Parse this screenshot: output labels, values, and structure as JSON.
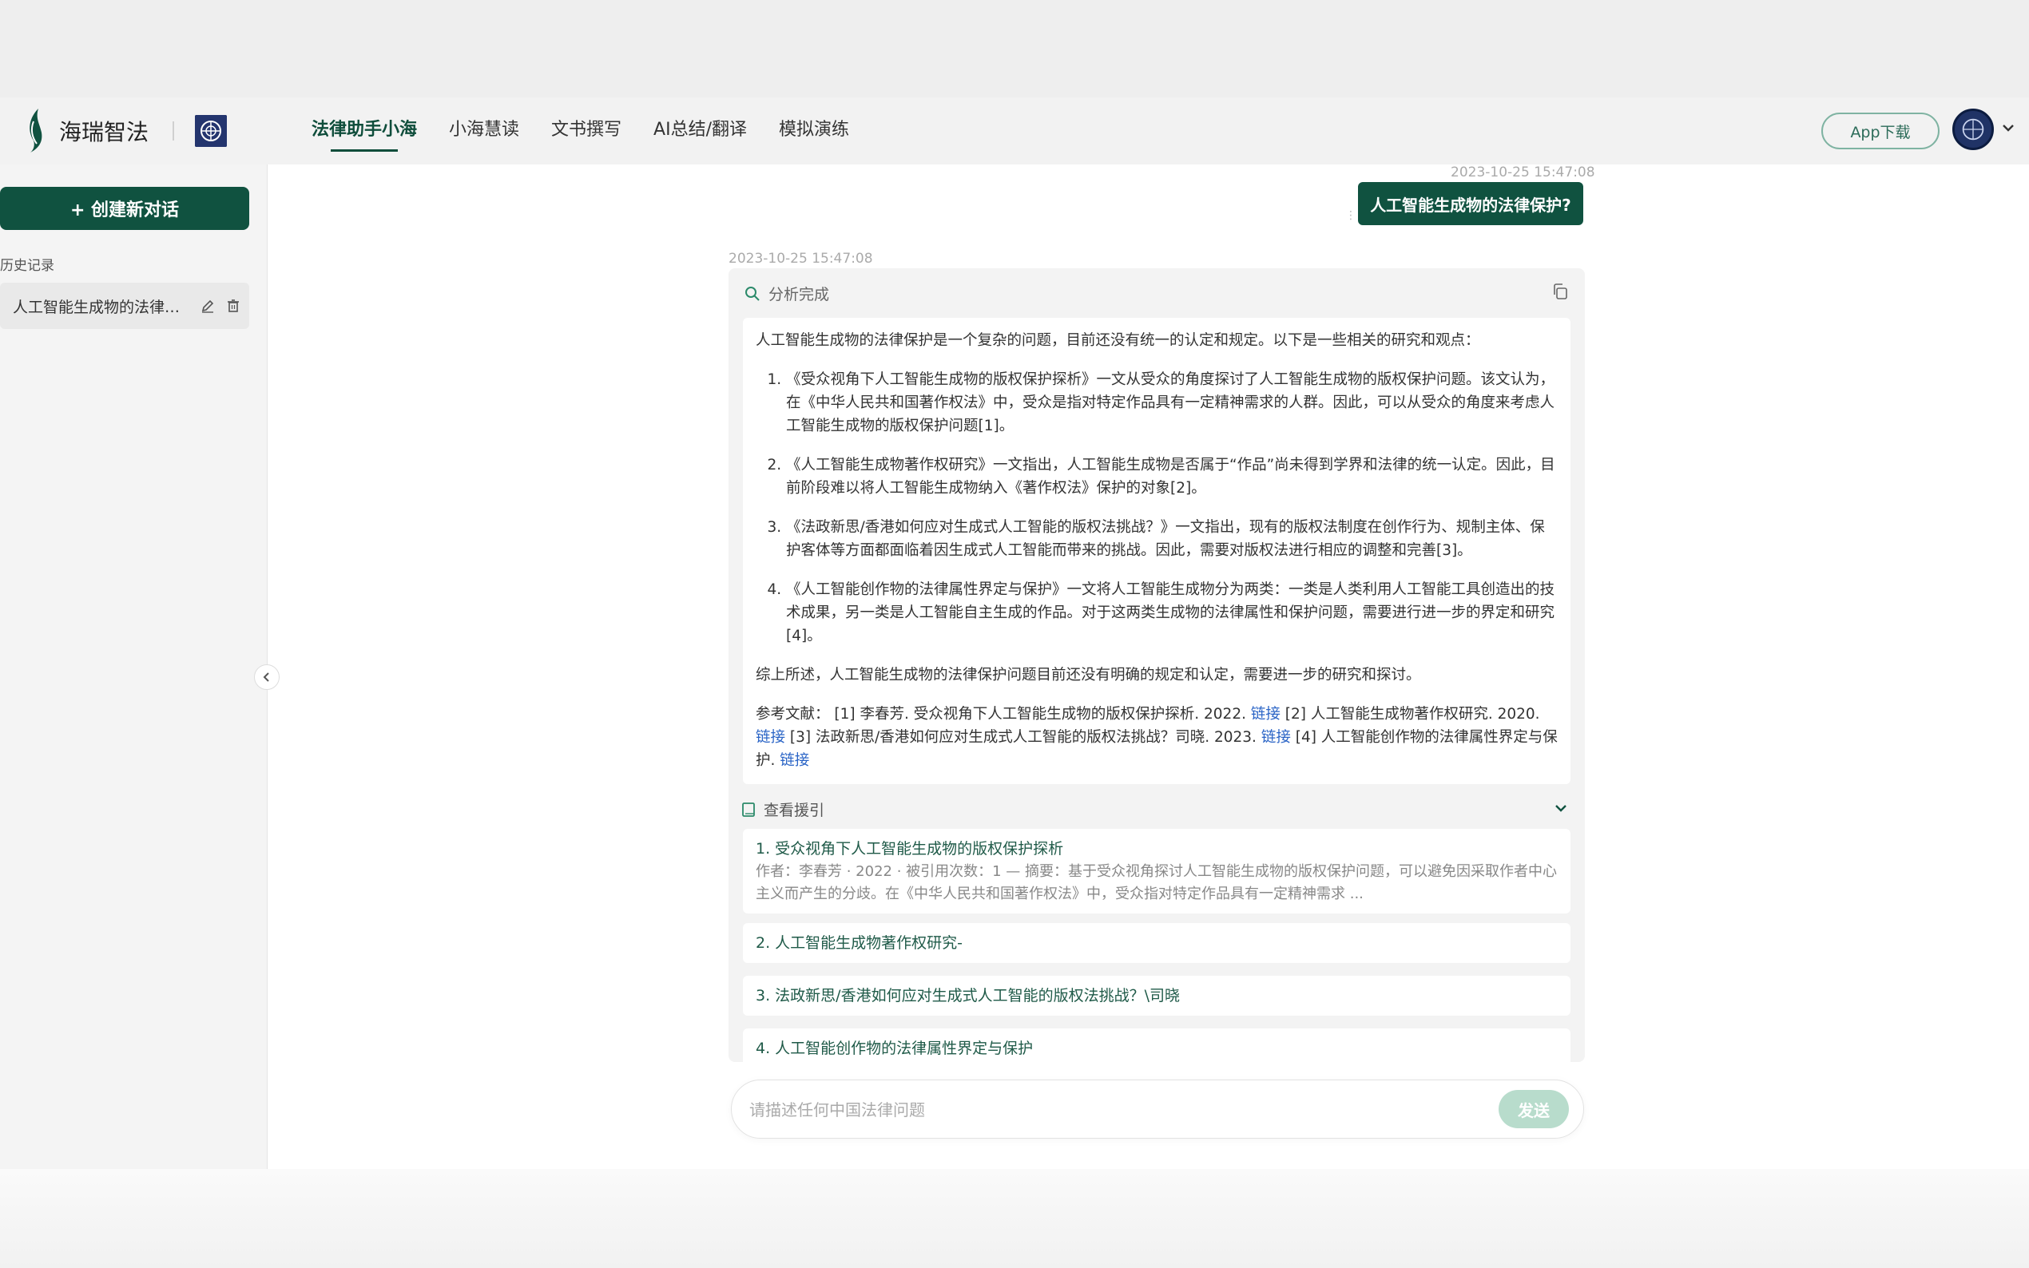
{
  "brand": {
    "name": "海瑞智法"
  },
  "nav": {
    "items": [
      {
        "label": "法律助手小海",
        "active": true
      },
      {
        "label": "小海慧读",
        "active": false
      },
      {
        "label": "文书撰写",
        "active": false
      },
      {
        "label": "AI总结/翻译",
        "active": false
      },
      {
        "label": "模拟演练",
        "active": false
      }
    ],
    "app_download": "App下载"
  },
  "sidebar": {
    "new_chat": "+ 创建新对话",
    "history_label": "历史记录",
    "history_items": [
      {
        "label": "人工智能生成物的法律保护?"
      }
    ]
  },
  "chat": {
    "user_timestamp": "2023-10-25 15:47:08",
    "user_question": "人工智能生成物的法律保护?",
    "answer_timestamp": "2023-10-25 15:47:08",
    "status": "分析完成",
    "answer": {
      "intro": "人工智能生成物的法律保护是一个复杂的问题，目前还没有统一的认定和规定。以下是一些相关的研究和观点：",
      "points": [
        "《受众视角下人工智能生成物的版权保护探析》一文从受众的角度探讨了人工智能生成物的版权保护问题。该文认为，在《中华人民共和国著作权法》中，受众是指对特定作品具有一定精神需求的人群。因此，可以从受众的角度来考虑人工智能生成物的版权保护问题[1]。",
        "《人工智能生成物著作权研究》一文指出，人工智能生成物是否属于“作品”尚未得到学界和法律的统一认定。因此，目前阶段难以将人工智能生成物纳入《著作权法》保护的对象[2]。",
        "《法政新思/香港如何应对生成式人工智能的版权法挑战？》一文指出，现有的版权法制度在创作行为、规制主体、保护客体等方面都面临着因生成式人工智能而带来的挑战。因此，需要对版权法进行相应的调整和完善[3]。",
        "《人工智能创作物的法律属性界定与保护》一文将人工智能生成物分为两类：一类是人类利用人工智能工具创造出的技术成果，另一类是人工智能自主生成的作品。对于这两类生成物的法律属性和保护问题，需要进行进一步的界定和研究[4]。"
      ],
      "summary": "综上所述，人工智能生成物的法律保护问题目前还没有明确的规定和认定，需要进一步的研究和探讨。",
      "refs": {
        "prefix": "参考文献：",
        "r1": " [1] 李春芳. 受众视角下人工智能生成物的版权保护探析. 2022. ",
        "r2": " [2] 人工智能生成物著作权研究. 2020. ",
        "r3": " [3] 法政新思/香港如何应对生成式人工智能的版权法挑战？司晓. 2023. ",
        "r4": " [4] 人工智能创作物的法律属性界定与保护. ",
        "link": "链接"
      }
    },
    "citations_label": "查看援引",
    "citations": [
      {
        "title": "1. 受众视角下人工智能生成物的版权保护探析",
        "meta": "作者：李春芳 · 2022 · 被引用次数：1 — 摘要：基于受众视角探讨人工智能生成物的版权保护问题，可以避免因采取作者中心主义而产生的分歧。在《中华人民共和国著作权法》中，受众指对特定作品具有一定精神需求 ..."
      },
      {
        "title": "2. 人工智能生成物著作权研究-"
      },
      {
        "title": "3. 法政新思/香港如何应对生成式人工智能的版权法挑战？\\司晓"
      },
      {
        "title": "4. 人工智能创作物的法律属性界定与保护"
      }
    ]
  },
  "input": {
    "placeholder": "请描述任何中国法律问题",
    "send": "发送"
  },
  "colors": {
    "brand_green": "#105240",
    "link_blue": "#2a64c6"
  }
}
